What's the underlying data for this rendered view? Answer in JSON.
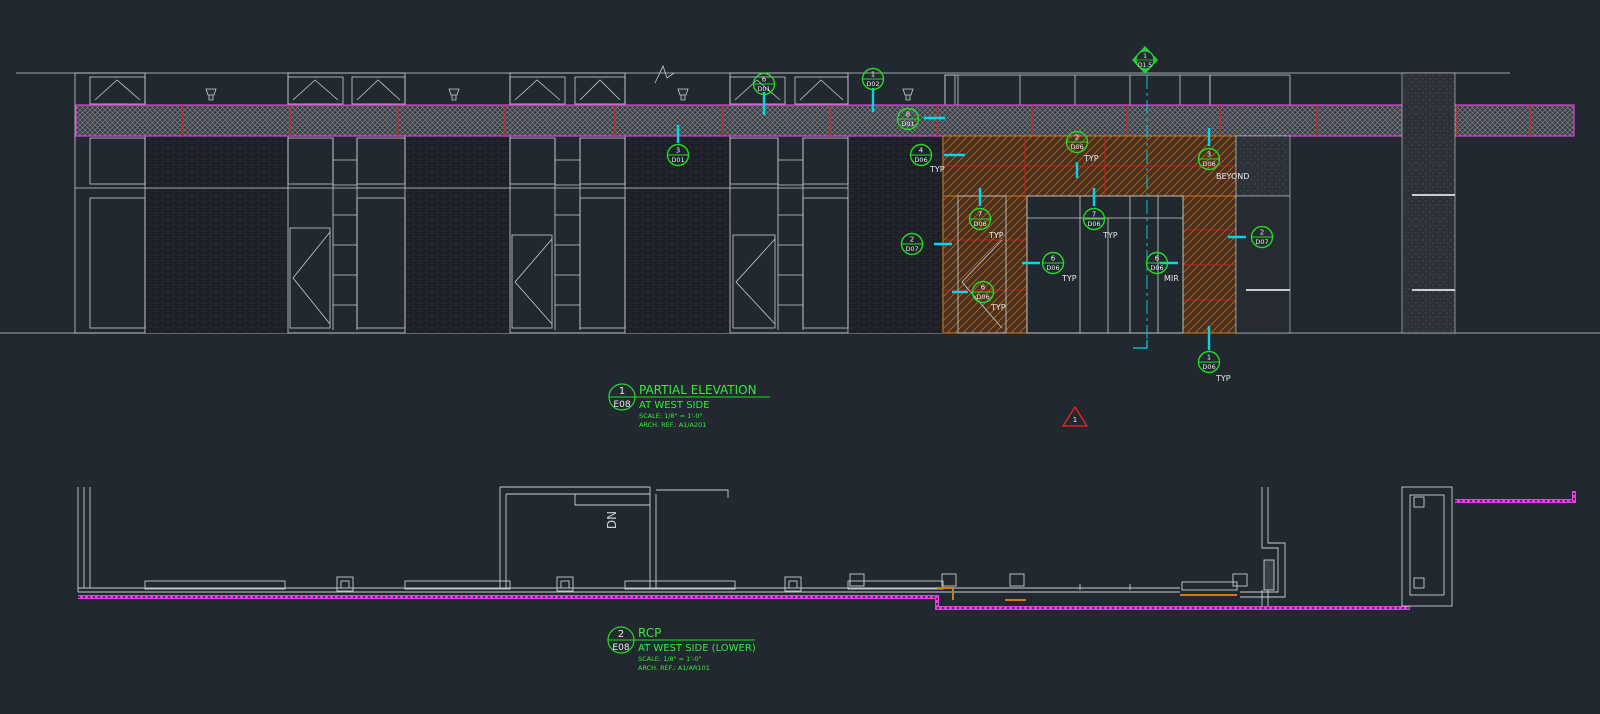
{
  "colors": {
    "background": "#212830",
    "linework": "#c9ced3",
    "brick": "#1c2026",
    "tag": "#22dd22",
    "title_text": "#33ee33",
    "leader": "#00d8e8",
    "highlight_magenta": "#e040e0",
    "panel_orange": "#d07a1a",
    "panel_red": "#e01a1a",
    "revision_red": "#ff2020"
  },
  "elevation": {
    "callouts": [
      {
        "num": "6",
        "ref": "D01",
        "note": ""
      },
      {
        "num": "1",
        "ref": "D02",
        "note": ""
      },
      {
        "num": "8",
        "ref": "D01",
        "note": ""
      },
      {
        "num": "3",
        "ref": "D01",
        "note": ""
      },
      {
        "num": "2",
        "ref": "D06",
        "note": "TYP"
      },
      {
        "num": "4",
        "ref": "D06",
        "note": "TYP"
      },
      {
        "num": "3",
        "ref": "D06",
        "note": "BEYOND"
      },
      {
        "num": "7",
        "ref": "D06",
        "note": "TYP"
      },
      {
        "num": "7",
        "ref": "D06",
        "note": "TYP"
      },
      {
        "num": "2",
        "ref": "D07",
        "note": ""
      },
      {
        "num": "2",
        "ref": "D07",
        "note": ""
      },
      {
        "num": "6",
        "ref": "D06",
        "note": "TYP"
      },
      {
        "num": "6",
        "ref": "D06",
        "note": "MIR"
      },
      {
        "num": "6",
        "ref": "D06",
        "note": "TYP"
      },
      {
        "num": "1",
        "ref": "D06",
        "note": "TYP"
      }
    ],
    "section_marker": {
      "num": "1",
      "ref": "D1.5"
    }
  },
  "title_blocks": [
    {
      "num": "1",
      "sheet": "E08",
      "title": "PARTIAL ELEVATION",
      "subtitle": "AT WEST SIDE",
      "scale": "SCALE: 1/8\" = 1'-0\"",
      "arch_ref": "ARCH. REF.: A1/A201"
    },
    {
      "num": "2",
      "sheet": "E08",
      "title": "RCP",
      "subtitle": "AT WEST SIDE (LOWER)",
      "scale": "SCALE: 1/8\" = 1'-0\"",
      "arch_ref": "ARCH. REF.: A1/AR101"
    }
  ],
  "revision": {
    "num": "1"
  },
  "rcp": {
    "room_label": "DN"
  }
}
